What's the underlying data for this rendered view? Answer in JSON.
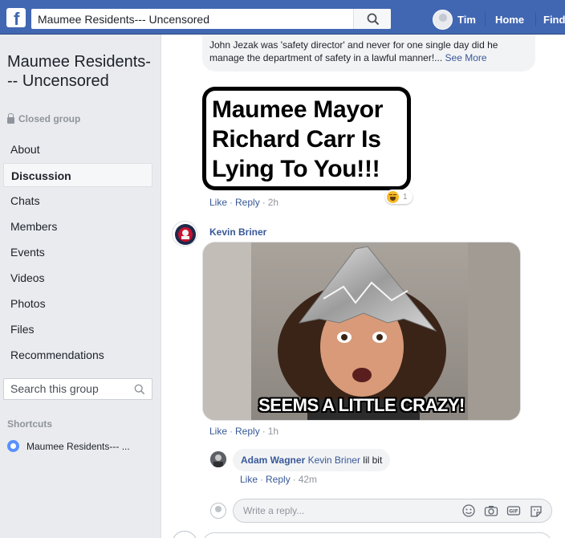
{
  "header": {
    "search_value": "Maumee Residents--- Uncensored",
    "user_name": "Tim",
    "nav_home": "Home",
    "nav_find": "Find"
  },
  "group": {
    "title": "Maumee Residents--- Uncensored",
    "privacy": "Closed group"
  },
  "sidebar": {
    "items": [
      {
        "label": "About"
      },
      {
        "label": "Discussion",
        "active": true
      },
      {
        "label": "Chats"
      },
      {
        "label": "Members"
      },
      {
        "label": "Events"
      },
      {
        "label": "Videos"
      },
      {
        "label": "Photos"
      },
      {
        "label": "Files"
      },
      {
        "label": "Recommendations"
      }
    ],
    "search_placeholder": "Search this group",
    "shortcuts_heading": "Shortcuts",
    "shortcut_label": "Maumee Residents--- ..."
  },
  "feed": {
    "comment1": {
      "text": "John Jezak was 'safety director' and never for one single day did he manage the department of safety in a lawful manner!...",
      "see_more": "See More"
    },
    "meme1": {
      "text": "Maumee Mayor\nRichard Carr Is\nLying To You!!!",
      "reaction_count": "1",
      "like": "Like",
      "reply": "Reply",
      "time": "2h"
    },
    "comment2": {
      "author": "Kevin Briner",
      "gif_caption": "SEEMS A LITTLE CRAZY!",
      "like": "Like",
      "reply": "Reply",
      "time": "1h"
    },
    "reply1": {
      "author": "Adam Wagner",
      "tag": "Kevin Briner",
      "text": "lil bit",
      "like": "Like",
      "reply": "Reply",
      "time": "42m"
    },
    "reply_box": {
      "placeholder": "Write a reply..."
    }
  },
  "colors": {
    "brand": "#4267b2",
    "link": "#385898",
    "meta": "#90949c",
    "sidebar_bg": "#e9ebee",
    "bubble_bg": "#f2f3f5"
  }
}
